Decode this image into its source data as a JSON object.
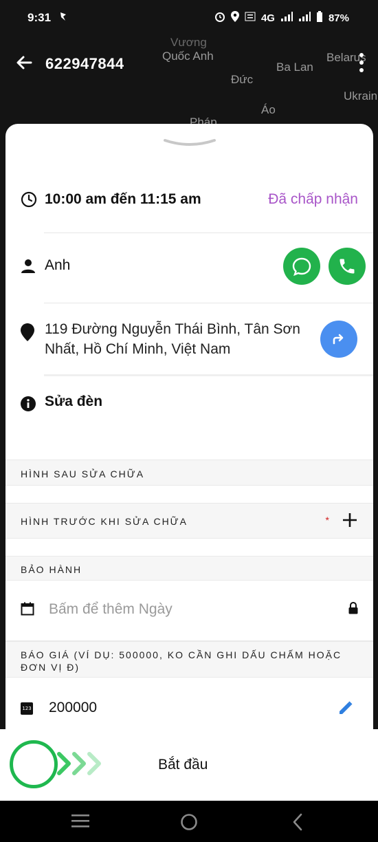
{
  "status_bar": {
    "time": "9:31",
    "network": "4G",
    "battery": "87%"
  },
  "map": {
    "labels": [
      "Vương",
      "Quốc Anh",
      "Ba Lan",
      "Belarus",
      "Đức",
      "Áo",
      "Pháp",
      "Ukrain"
    ]
  },
  "header": {
    "order_id": "622947844"
  },
  "details": {
    "time_range": "10:00 am đến 11:15 am",
    "status": "Đã chấp nhận",
    "customer_name": "Anh",
    "address": "119 Đường Nguyễn Thái Bình, Tân Sơn Nhất, Hồ Chí Minh, Việt Nam",
    "note": "Sửa đèn"
  },
  "sections": {
    "after_photos": "HÌNH SAU SỬA CHỮA",
    "before_photos": "HÌNH TRƯỚC KHI SỬA CHỮA",
    "required_mark": "*",
    "warranty": "BẢO HÀNH",
    "warranty_placeholder": "Bấm để thêm Ngày",
    "quote": "BÁO GIÁ (VÍ DỤ: 500000, KO CẦN GHI DẤU CHẤM HOẶC ĐƠN VỊ Đ)",
    "quote_icon_text": "123",
    "quote_value": "200000"
  },
  "bottom": {
    "start_label": "Bắt đầu"
  },
  "colors": {
    "accent_purple": "#a855c8",
    "green": "#22b24c",
    "blue": "#4a8ff0",
    "red": "#d21f1f"
  }
}
